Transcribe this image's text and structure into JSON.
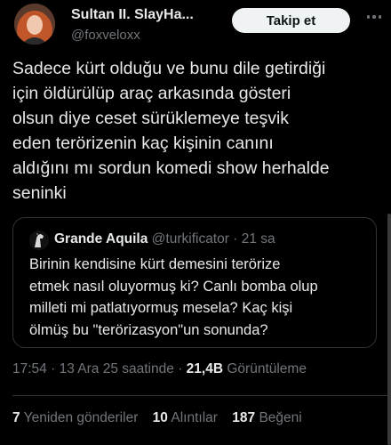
{
  "author": {
    "display_name": "Sultan II. SlayHa...",
    "handle": "@foxveloxx",
    "follow_label": "Takip et"
  },
  "tweet": {
    "text": "Sadece kürt olduğu ve bunu dile getirdiği\niçin öldürülüp araç arkasında gösteri\nolsun diye ceset sürüklemeye teşvik\neden terörizenin kaç kişinin canını\naldığını mı sordun komedi show herhalde\nseninki"
  },
  "quoted_tweet": {
    "display_name": "Grande Aquila",
    "handle": "@turkificator",
    "separator": "·",
    "time": "21 sa",
    "text": "Birinin kendisine kürt demesini terörize\netmek nasıl oluyormuş ki? Canlı bomba olup\nmilleti mi patlatıyormuş mesela? Kaç kişi\nölmüş bu \"terörizasyon\"un sonunda?"
  },
  "meta": {
    "time": "17:54",
    "separator1": "·",
    "date": "13 Ara 25 saatinde",
    "separator2": "·",
    "views_count": "21,4B",
    "views_label": "Görüntüleme"
  },
  "stats": {
    "reposts_count": "7",
    "reposts_label": "Yeniden gönderiler",
    "quotes_count": "10",
    "quotes_label": "Alıntılar",
    "likes_count": "187",
    "likes_label": "Beğeni"
  },
  "colors": {
    "background": "#000000",
    "text": "#e7e9ea",
    "secondary_text": "#71767b",
    "border": "#2f3336",
    "follow_button_bg": "#eff3f4"
  },
  "icons": [
    "avatar-photo",
    "more-options-icon",
    "quoted-avatar-horse-icon"
  ]
}
